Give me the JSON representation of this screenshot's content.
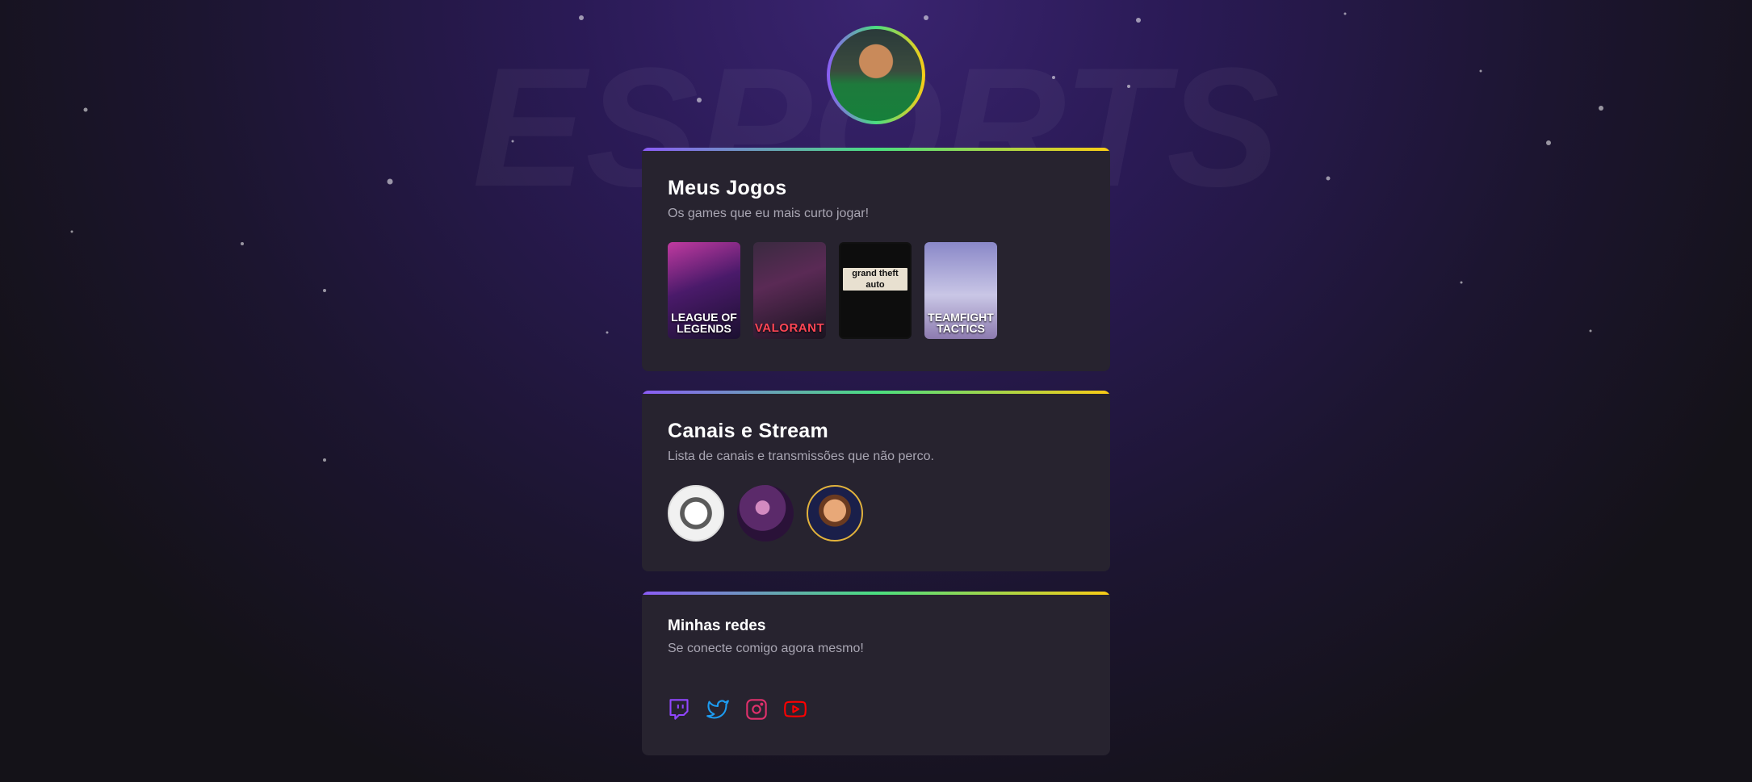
{
  "background": {
    "watermark_text": "ESPORTS"
  },
  "profile": {
    "avatar_icon": "profile-photo"
  },
  "games_card": {
    "title": "Meus Jogos",
    "subtitle": "Os games que eu mais curto jogar!",
    "games": [
      {
        "name": "LEAGUE OF LEGENDS",
        "label": "LEAGUE OF LEGENDS"
      },
      {
        "name": "VALORANT",
        "label": "VALORANT"
      },
      {
        "name": "Grand Theft Auto V",
        "label": "grand theft auto"
      },
      {
        "name": "TEAMFIGHT TACTICS",
        "label": "TEAMFIGHT TACTICS"
      }
    ]
  },
  "channels_card": {
    "title": "Canais e Stream",
    "subtitle": "Lista de canais e transmissões que não perco.",
    "channels": [
      {
        "icon": "tiger-logo"
      },
      {
        "icon": "streamer-photo"
      },
      {
        "icon": "cartoon-avatar"
      }
    ]
  },
  "socials_card": {
    "title": "Minhas redes",
    "subtitle": "Se conecte comigo agora mesmo!",
    "links": [
      {
        "icon": "twitch-icon",
        "color": "#9146ff"
      },
      {
        "icon": "twitter-icon",
        "color": "#1d9bf0"
      },
      {
        "icon": "instagram-icon",
        "color": "#e1306c"
      },
      {
        "icon": "youtube-icon",
        "color": "#ff0000"
      }
    ]
  },
  "colors": {
    "accent_gradient": [
      "#8b5cf6",
      "#4ade80",
      "#facc15"
    ],
    "card_bg": "#27232f",
    "page_bg": "#141218"
  }
}
